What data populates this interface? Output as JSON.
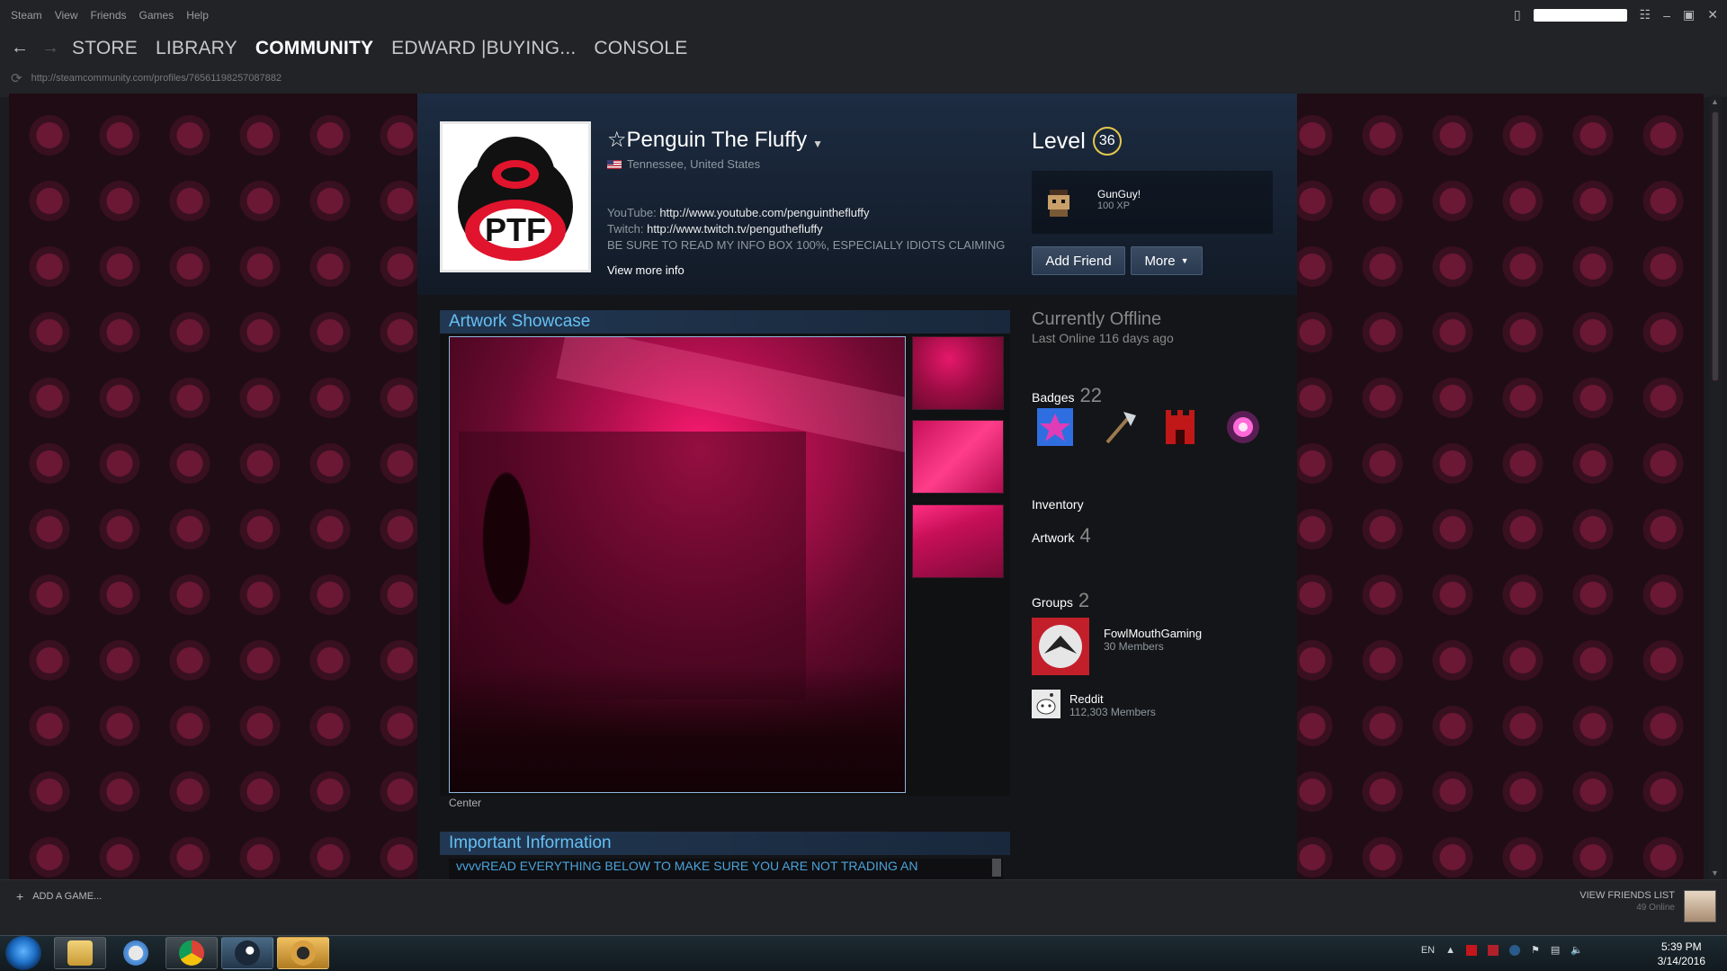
{
  "menu": [
    "Steam",
    "View",
    "Friends",
    "Games",
    "Help"
  ],
  "nav": {
    "tabs": [
      "STORE",
      "LIBRARY",
      "COMMUNITY",
      "EDWARD |BUYING...",
      "CONSOLE"
    ],
    "url": "http://steamcommunity.com/profiles/76561198257087882"
  },
  "profile": {
    "persona_name": "☆Penguin The Fluffy",
    "location": "Tennessee, United States",
    "summary_line1_label": "YouTube:",
    "summary_line1_link": "http://www.youtube.com/penguinthefluffy",
    "summary_line2_label": "Twitch:",
    "summary_line2_link": "http://www.twitch.tv/penguthefluffy",
    "summary_line3": "BE SURE TO READ MY INFO BOX 100%, ESPECIALLY IDIOTS CLAIMING",
    "view_more": "View more info",
    "avatar_text": "PTF",
    "level_label": "Level",
    "level": "36",
    "favorite_badge_name": "GunGuy!",
    "favorite_badge_xp": "100 XP",
    "add_friend": "Add Friend",
    "more": "More"
  },
  "showcase": {
    "title": "Artwork Showcase",
    "caption": "Center"
  },
  "info": {
    "title": "Important Information",
    "text": "vvvvREAD EVERYTHING BELOW TO MAKE SURE YOU ARE NOT TRADING AN"
  },
  "sidebar": {
    "status": "Currently Offline",
    "last_online": "Last Online 116 days ago",
    "badges_label": "Badges",
    "badges_count": "22",
    "inventory_label": "Inventory",
    "artwork_label": "Artwork",
    "artwork_count": "4",
    "groups_label": "Groups",
    "groups_count": "2",
    "groups": [
      {
        "name": "FowlMouthGaming",
        "members": "30 Members"
      },
      {
        "name": "Reddit",
        "members": "112,303 Members"
      }
    ]
  },
  "footer": {
    "add_game": "ADD A GAME...",
    "view_friends": "VIEW FRIENDS LIST",
    "online": "49 Online"
  },
  "taskbar": {
    "lang": "EN",
    "time": "5:39 PM",
    "date": "3/14/2016"
  },
  "icons": {
    "back": "arrow-left",
    "forward": "arrow-right",
    "reload": "reload",
    "caret": "chevron-down"
  },
  "colors": {
    "accent_blue": "#66c0f4",
    "level_ring": "#e6c84c",
    "background_pattern": "#6a1833"
  }
}
